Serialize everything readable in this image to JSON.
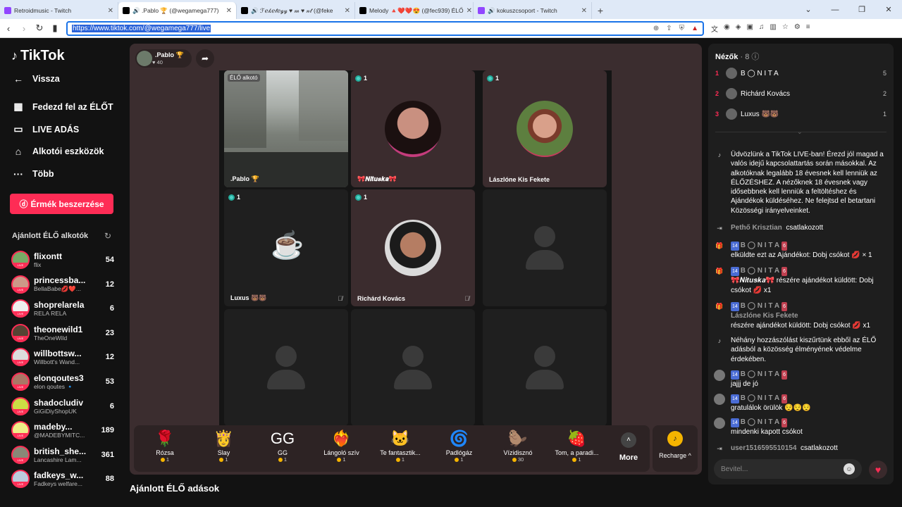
{
  "browser": {
    "tabs": [
      {
        "title": "Retroidmusic - Twitch",
        "color": "#9146ff"
      },
      {
        "title": "🔊 .Pablo 🏆 (@wegamega777)",
        "color": "#000000",
        "active": true
      },
      {
        "title": "🔊 ℱℯ𝓀ℯ𝓉ℯℊ𝓎 ♥ 𝓂 ♥ 𝓃𝓉 (@feke",
        "color": "#000000"
      },
      {
        "title": "Melody 🔺❤️❤️😍 (@fec939) ÉLŐ",
        "color": "#000000"
      },
      {
        "title": "🔊 kokuszcsoport - Twitch",
        "color": "#9146ff"
      }
    ],
    "url": "https://www.tiktok.com/@wegamega777/live"
  },
  "sidebar": {
    "logo": "TikTok",
    "back": "Vissza",
    "nav": [
      "Fedezd fel az ÉLŐT",
      "LIVE ADÁS",
      "Alkotói eszközök",
      "Több"
    ],
    "coins_button": "Érmék beszerzése",
    "recommended_title": "Ajánlott ÉLŐ alkotók",
    "accounts": [
      {
        "name": "flixontt",
        "sub": "flix",
        "count": "54",
        "color": "#7a6"
      },
      {
        "name": "princessba...",
        "sub": "BellaBabe💋❤️...",
        "count": "12",
        "color": "#c98"
      },
      {
        "name": "shoprelarela",
        "sub": "RELA RELA",
        "count": "6",
        "color": "#eee"
      },
      {
        "name": "theonewild1",
        "sub": "TheOneWild",
        "count": "23",
        "color": "#543"
      },
      {
        "name": "willbottsw...",
        "sub": "Willbott's Wand...",
        "count": "12",
        "color": "#ddd"
      },
      {
        "name": "elonqoutes3",
        "sub": "elon qoutes 🔹",
        "count": "53",
        "color": "#a76"
      },
      {
        "name": "shadocludiv",
        "sub": "GiGiDiyShopUK",
        "count": "6",
        "color": "#cd4"
      },
      {
        "name": "madeby...",
        "sub": "@MADEBYMITC...",
        "count": "189",
        "color": "#ee8"
      },
      {
        "name": "british_she...",
        "sub": "Lancashire Lam...",
        "count": "361",
        "color": "#887"
      },
      {
        "name": "fadkeys_w...",
        "sub": "Fadkeys welfare...",
        "count": "88",
        "color": "#bcd"
      }
    ]
  },
  "stage": {
    "host_name": ".Pablo 🏆",
    "host_likes": "♥ 40",
    "cells": [
      {
        "name": ".Pablo 🏆",
        "badge": "",
        "tag": "ÉLŐ alkotó"
      },
      {
        "name": "🎀𝑵𝒊𝒕𝒖𝒔𝒌𝒂🎀",
        "badge": "1"
      },
      {
        "name": "Lászlóne Kis Fekete",
        "badge": "1"
      },
      {
        "name": "Luxus 🐻🐻",
        "badge": "1"
      },
      {
        "name": "Richárd Kovács",
        "badge": "1"
      }
    ],
    "gifts": [
      {
        "icon": "🌹",
        "name": "Rózsa",
        "price": "1"
      },
      {
        "icon": "👸",
        "name": "Slay",
        "price": "1"
      },
      {
        "icon": "GG",
        "name": "GG",
        "price": "1"
      },
      {
        "icon": "❤️‍🔥",
        "name": "Lángoló szív",
        "price": "1"
      },
      {
        "icon": "🐱",
        "name": "Te fantasztik...",
        "price": "1"
      },
      {
        "icon": "🌀",
        "name": "Padlógáz",
        "price": "1"
      },
      {
        "icon": "🦫",
        "name": "Vízidisznó",
        "price": "30"
      },
      {
        "icon": "🍓",
        "name": "Tom, a paradi...",
        "price": "1"
      }
    ],
    "more": "More",
    "recharge": "Recharge ^",
    "section_title": "Ajánlott ÉLŐ adások"
  },
  "chat": {
    "viewers_title": "Nézők",
    "viewers_count": "· 8",
    "viewers": [
      {
        "rank": "1",
        "name": "B ◯ N I T A",
        "score": "5"
      },
      {
        "rank": "2",
        "name": "Richárd Kovács",
        "score": "2"
      },
      {
        "rank": "3",
        "name": "Luxus 🐻🐻",
        "score": "1"
      }
    ],
    "welcome": "Üdvözlünk a TikTok LIVE-ban! Érezd jól magad a valós idejű kapcsolattartás során másokkal. Az alkotóknak legalább 18 évesnek kell lenniük az ÉLŐZÉSHEZ. A nézőknek 18 évesnek vagy idősebbnek kell lenniük a feltöltéshez és Ajándékok küldéséhez. Ne felejtsd el betartani Közösségi irányelveinket.",
    "join1_user": "Pethő Krisztian",
    "join1_text": "csatlakozott",
    "m1_user": "B ◯ N I T A",
    "m1_text": "elküldte ezt az Ajándékot: Dobj csókot 💋 × 1",
    "m2_user": "B ◯ N I T A",
    "m2_text": "🎀𝑵𝒊𝒕𝒖𝒔𝒌𝒂🎀 részére ajándékot küldött: Dobj csókot 💋 x1",
    "m3_user": "B ◯ N I T A",
    "m3_name2": "Lászlóne Kis Fekete",
    "m3_text": "részére ajándékot küldött: Dobj csókot 💋 x1",
    "filtered": "Néhány hozzászólást kiszűrtünk ebből az ÉLŐ adásból a közösség élményének védelme érdekében.",
    "m4_user": "B ◯ N I T A",
    "m4_text": "jajjj de jó",
    "m5_user": "B ◯ N I T A",
    "m5_text": "gratulálok örülök 😌😌😌",
    "m6_user": "B ◯ N I T A",
    "m6_text": "mindenki kapott csókot",
    "join2_user": "user1516595510154",
    "join2_text": "csatlakozott",
    "level": "14",
    "fan": "6",
    "input_placeholder": "Bevitel..."
  }
}
